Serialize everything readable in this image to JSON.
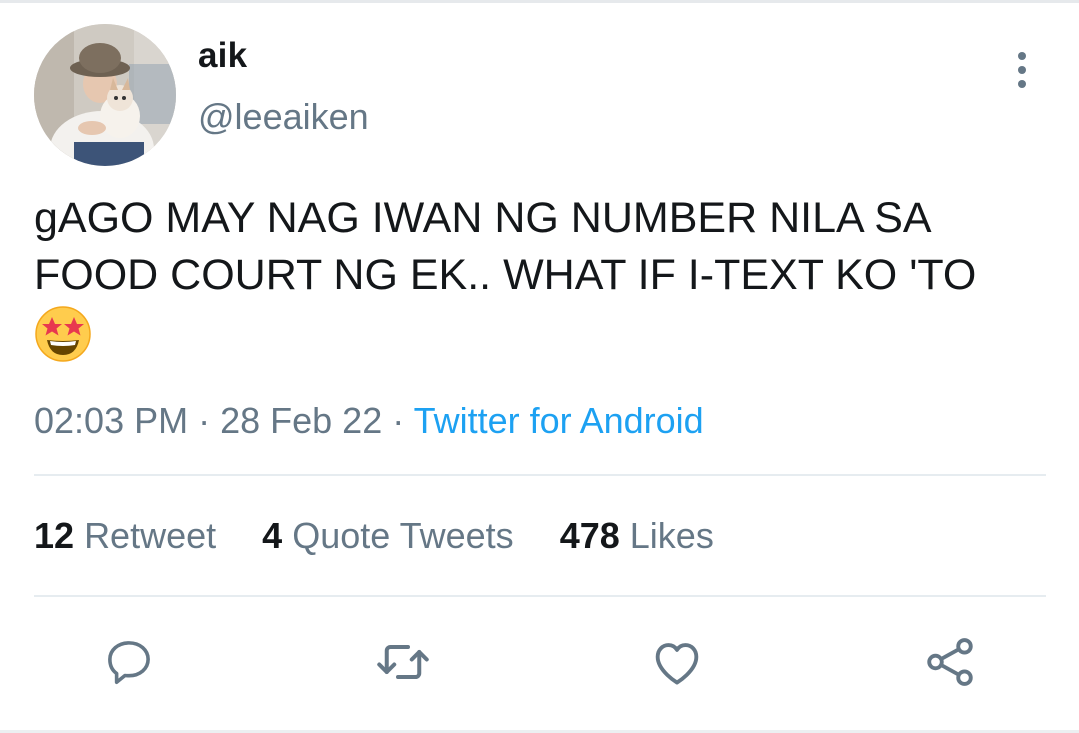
{
  "user": {
    "display_name": "aik",
    "handle": "@leeaiken"
  },
  "tweet": {
    "text": "gAGO MAY NAG IWAN NG NUMBER NILA SA\nFOOD COURT NG EK.. WHAT IF I-TEXT KO 'TO",
    "emoji": "star-struck-emoji"
  },
  "meta": {
    "time": "02:03 PM",
    "separator": " · ",
    "date": "28 Feb 22",
    "source": "Twitter for Android"
  },
  "stats": {
    "retweets": {
      "count": "12",
      "label": "Retweet"
    },
    "quotes": {
      "count": "4",
      "label": "Quote Tweets"
    },
    "likes": {
      "count": "478",
      "label": "Likes"
    }
  },
  "actions": [
    "reply-icon",
    "retweet-icon",
    "like-icon",
    "share-icon"
  ],
  "colors": {
    "text": "#14171a",
    "secondary": "#657786",
    "link": "#1da1f2",
    "divider": "#e6ecf0"
  }
}
